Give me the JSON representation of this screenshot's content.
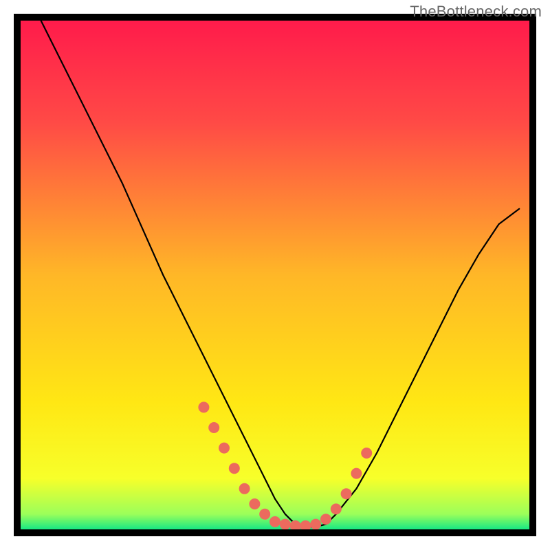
{
  "watermark": "TheBottleneck.com",
  "chart_data": {
    "type": "line",
    "title": "",
    "xlabel": "",
    "ylabel": "",
    "xlim": [
      0,
      100
    ],
    "ylim": [
      0,
      100
    ],
    "grid": false,
    "legend": false,
    "curve": {
      "note": "Single black asymmetric V-shaped curve on a vertical red-yellow-green gradient. Values are estimated from the image as percentage of plot height (0 = bottom, 100 = top).",
      "x": [
        4,
        8,
        12,
        16,
        20,
        24,
        28,
        32,
        36,
        40,
        44,
        48,
        50,
        52,
        54,
        56,
        58,
        60,
        62,
        66,
        70,
        74,
        78,
        82,
        86,
        90,
        94,
        98
      ],
      "y": [
        100,
        92,
        84,
        76,
        68,
        59,
        50,
        42,
        34,
        26,
        18,
        10,
        6,
        3,
        1,
        0.5,
        0.5,
        1,
        3,
        8,
        15,
        23,
        31,
        39,
        47,
        54,
        60,
        63
      ]
    },
    "markers": {
      "note": "Salmon-colored dot clusters on the curve near the valley floor and on the lower slopes.",
      "color": "#ec6a5e",
      "radius_px": 8,
      "points_x_pct": [
        36,
        38,
        40,
        42,
        44,
        46,
        48,
        50,
        52,
        54,
        56,
        58,
        60,
        62,
        64,
        66,
        68
      ],
      "points_y_pct": [
        24,
        20,
        16,
        12,
        8,
        5,
        3,
        1.5,
        1,
        0.7,
        0.7,
        1,
        2,
        4,
        7,
        11,
        15
      ]
    },
    "background_gradient": {
      "direction": "vertical",
      "stops": [
        {
          "pos": 0.0,
          "color": "#ff1b4b"
        },
        {
          "pos": 0.2,
          "color": "#ff4a46"
        },
        {
          "pos": 0.5,
          "color": "#ffb727"
        },
        {
          "pos": 0.75,
          "color": "#ffe714"
        },
        {
          "pos": 0.9,
          "color": "#f7ff2a"
        },
        {
          "pos": 0.97,
          "color": "#9bff5a"
        },
        {
          "pos": 1.0,
          "color": "#17e884"
        }
      ]
    },
    "frame": {
      "color": "#000000",
      "stroke_px": 10
    }
  }
}
